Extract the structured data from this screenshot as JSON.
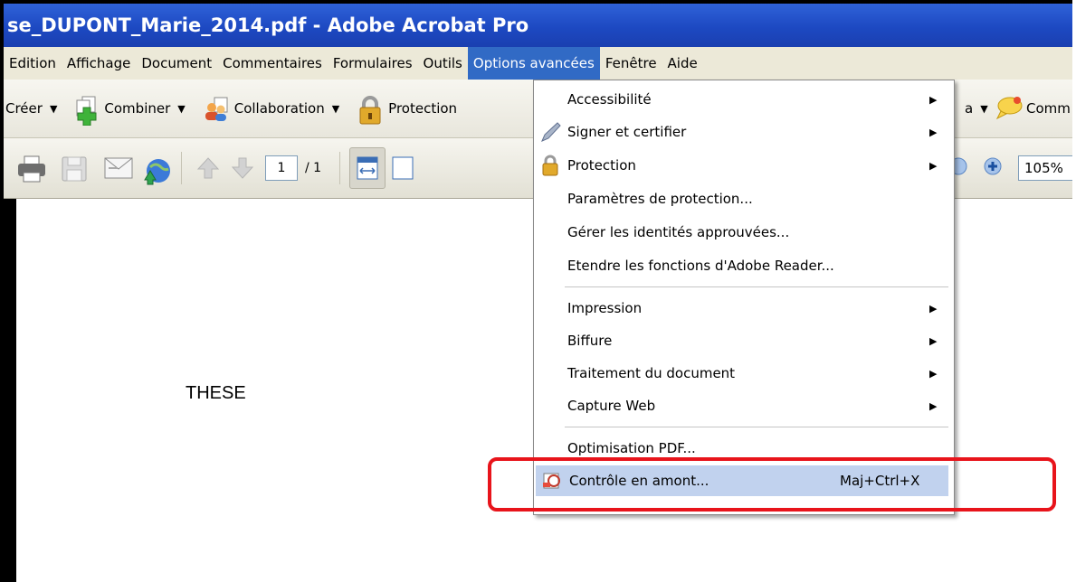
{
  "window": {
    "title": "se_DUPONT_Marie_2014.pdf - Adobe Acrobat Pro"
  },
  "menubar": {
    "items": [
      "Edition",
      "Affichage",
      "Document",
      "Commentaires",
      "Formulaires",
      "Outils",
      "Options avancées",
      "Fenêtre",
      "Aide"
    ],
    "active": "Options avancées"
  },
  "toolbar1": {
    "create": "Créer",
    "combine": "Combiner",
    "collaboration": "Collaboration",
    "protection": "Protection",
    "partial_right": "a",
    "comments_partial": "Comm"
  },
  "toolbar2": {
    "page_current": "1",
    "page_total": "/ 1",
    "zoom": "105%"
  },
  "document": {
    "text": "THESE"
  },
  "dropdown": {
    "items": [
      {
        "label": "Accessibilité",
        "submenu": true
      },
      {
        "label": "Signer et certifier",
        "submenu": true,
        "icon": "pen-icon"
      },
      {
        "label": "Protection",
        "submenu": true,
        "icon": "lock-icon"
      },
      {
        "label": "Paramètres de protection..."
      },
      {
        "label": "Gérer les identités approuvées..."
      },
      {
        "label": "Etendre les fonctions d'Adobe Reader..."
      },
      {
        "label": "Impression",
        "submenu": true
      },
      {
        "label": "Biffure",
        "submenu": true
      },
      {
        "label": "Traitement du document",
        "submenu": true
      },
      {
        "label": "Capture Web",
        "submenu": true
      },
      {
        "label": "Optimisation PDF..."
      },
      {
        "label": "Contrôle en amont...",
        "shortcut": "Maj+Ctrl+X",
        "icon": "preflight-icon",
        "highlighted": true
      }
    ]
  },
  "colors": {
    "titlebar": "#1d49c2",
    "menu_active": "#316ac5",
    "highlight_box": "#e8141b",
    "item_highlight": "#c1d2ee"
  }
}
